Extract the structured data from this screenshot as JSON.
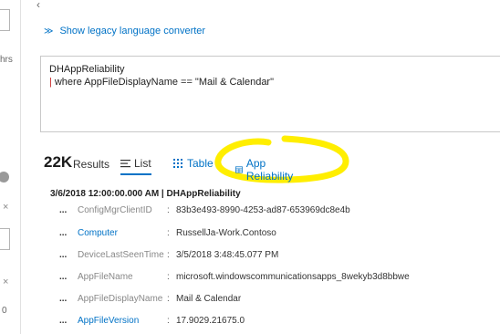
{
  "left_strip": {
    "frag_hrs": "hrs",
    "frag_zero": "0"
  },
  "legacy_link": {
    "chevron": "≫",
    "label": "Show legacy language converter"
  },
  "query": {
    "line1": "DHAppReliability",
    "pipe": "|",
    "line2": "where AppFileDisplayName == \"Mail & Calendar\""
  },
  "results": {
    "count": "22K",
    "label": "Results",
    "tabs": [
      {
        "label": "List",
        "icon": "list-icon",
        "active": true
      },
      {
        "label": "Table",
        "icon": "table-icon",
        "active": false
      },
      {
        "label": "App Reliability",
        "icon": "grid-icon",
        "active": false
      }
    ]
  },
  "record": {
    "title": "3/6/2018 12:00:00.000 AM | DHAppReliability",
    "fields": [
      {
        "dots": "...",
        "name": "ConfigMgrClientID",
        "sep": ":",
        "value": "83b3e493-8990-4253-ad87-653969dc8e4b",
        "link": false
      },
      {
        "dots": "...",
        "name": "Computer",
        "sep": ":",
        "value": "RussellJa-Work.Contoso",
        "link": true
      },
      {
        "dots": "...",
        "name": "DeviceLastSeenTime",
        "sep": ":",
        "value": "3/5/2018 3:48:45.077 PM",
        "link": false
      },
      {
        "dots": "...",
        "name": "AppFileName",
        "sep": ":",
        "value": "microsoft.windowscommunicationsapps_8wekyb3d8bbwe",
        "link": false
      },
      {
        "dots": "...",
        "name": "AppFileDisplayName",
        "sep": ":",
        "value": "Mail & Calendar",
        "link": false
      },
      {
        "dots": "...",
        "name": "AppFileVersion",
        "sep": ":",
        "value": "17.9029.21675.0",
        "link": true
      }
    ]
  },
  "colors": {
    "accent": "#0072c6",
    "highlight": "#ffee00",
    "pipe": "#c62828"
  }
}
